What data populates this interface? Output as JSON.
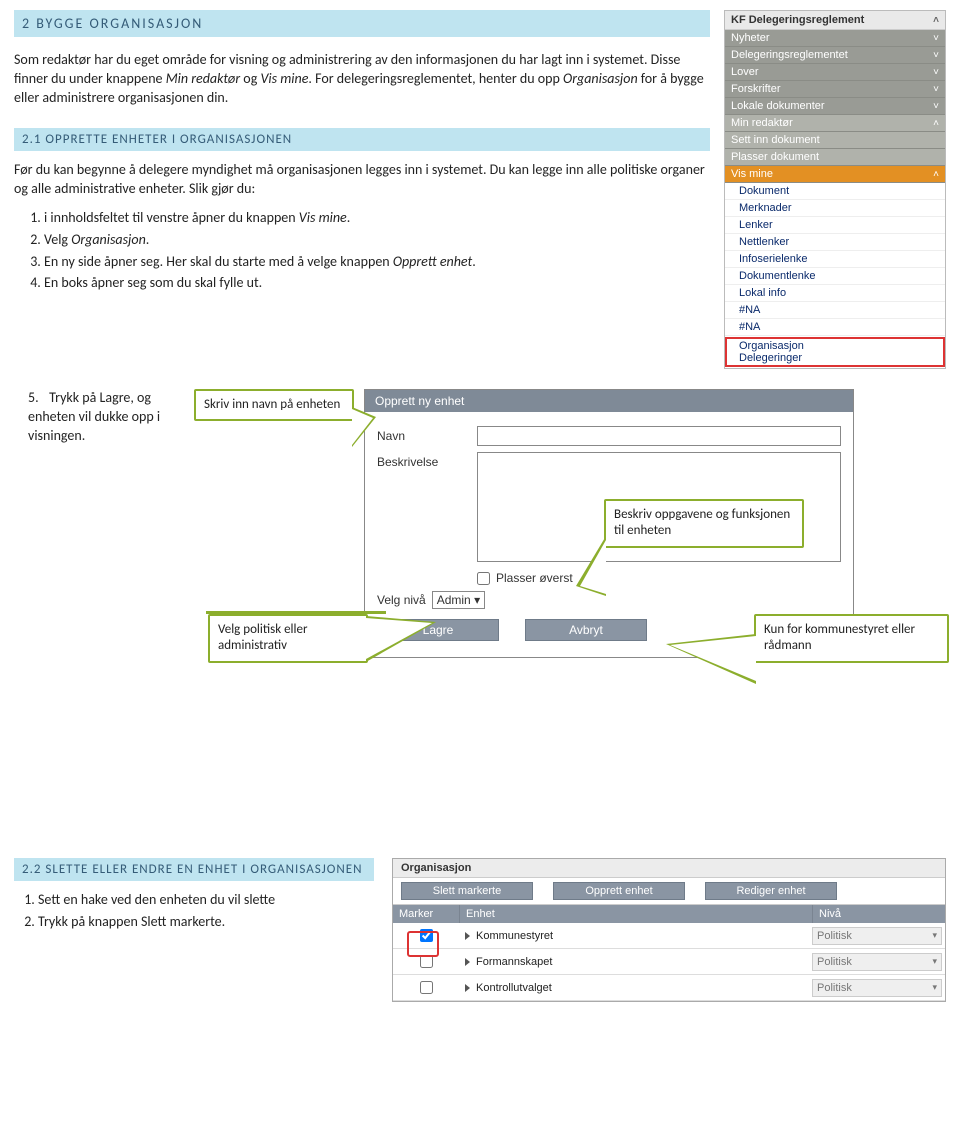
{
  "sec2": {
    "title": "2 BYGGE ORGANISASJON",
    "p1a": "Som redaktør har du eget område for visning og administrering av den informasjonen du har lagt inn i systemet. Disse finner du under knappene ",
    "p1_em1": "Min redaktør",
    "p1b": " og ",
    "p1_em2": "Vis mine",
    "p1c": ". For delegeringsreglementet, henter du opp ",
    "p1_em3": "Organisasjon",
    "p1d": " for å bygge eller administrere organisasjonen din."
  },
  "sec21": {
    "title": "2.1 OPPRETTE ENHETER I ORGANISASJONEN",
    "p1": "Før du kan begynne å delegere myndighet må organisasjonen legges inn i systemet. Du kan legge inn alle politiske organer og alle administrative enheter. Slik gjør du:",
    "steps": [
      {
        "a": "i innholdsfeltet til venstre åpner du knappen ",
        "em": "Vis mine",
        "b": "."
      },
      {
        "a": "Velg ",
        "em": "Organisasjon",
        "b": "."
      },
      {
        "a": "En ny side åpner seg. Her skal du starte med å velge knappen ",
        "em": "Opprett enhet",
        "b": "."
      },
      {
        "a": "En boks åpner seg som du skal fylle ut.",
        "em": "",
        "b": ""
      }
    ],
    "step5_num": "5.",
    "step5": "Trykk på Lagre, og enheten vil dukke opp i visningen."
  },
  "sidebar": {
    "title": "KF Delegeringsreglement",
    "items": [
      {
        "label": "Nyheter",
        "chev": "˅",
        "cls": ""
      },
      {
        "label": "Delegeringsreglementet",
        "chev": "˅",
        "cls": ""
      },
      {
        "label": "Lover",
        "chev": "˅",
        "cls": ""
      },
      {
        "label": "Forskrifter",
        "chev": "˅",
        "cls": ""
      },
      {
        "label": "Lokale dokumenter",
        "chev": "˅",
        "cls": ""
      },
      {
        "label": "Min redaktør",
        "chev": "˄",
        "cls": "sel"
      }
    ],
    "mid": [
      {
        "label": "Sett inn dokument"
      },
      {
        "label": "Plasser dokument"
      }
    ],
    "orange": {
      "label": "Vis mine",
      "chev": "˄"
    },
    "subs": [
      "Dokument",
      "Merknader",
      "Lenker",
      "Nettlenker",
      "Infoserielenke",
      "Dokumentlenke",
      "Lokal info",
      "#NA",
      "#NA"
    ],
    "redbox": [
      "Organisasjon",
      "Delegeringer"
    ]
  },
  "callouts": {
    "c1": "Skriv inn navn på enheten",
    "c2": "Velg politisk eller administrativ",
    "c3": "Beskriv oppgavene og funksjonen til enheten",
    "c4": "Kun for kommunestyret eller rådmann"
  },
  "form": {
    "head": "Opprett ny enhet",
    "navn_label": "Navn",
    "beskriv_label": "Beskrivelse",
    "plasser": "Plasser øverst",
    "velg_nivaa": "Velg nivå",
    "admin": "Admin",
    "admin_chev": "▾",
    "lagre": "Lagre",
    "avbryt": "Avbryt"
  },
  "sec22": {
    "title": "2.2 SLETTE ELLER ENDRE EN ENHET I ORGANISASJONEN",
    "steps": [
      "Sett en hake ved den enheten du vil slette",
      "Trykk på knappen Slett markerte."
    ]
  },
  "org": {
    "head": "Organisasjon",
    "btns": [
      "Slett markerte",
      "Opprett enhet",
      "Rediger enhet"
    ],
    "cols": [
      "Marker",
      "Enhet",
      "Nivå"
    ],
    "rows": [
      {
        "chk": true,
        "name": "Kommunestyret",
        "niv": "Politisk"
      },
      {
        "chk": false,
        "name": "Formannskapet",
        "niv": "Politisk"
      },
      {
        "chk": false,
        "name": "Kontrollutvalget",
        "niv": "Politisk"
      }
    ]
  }
}
